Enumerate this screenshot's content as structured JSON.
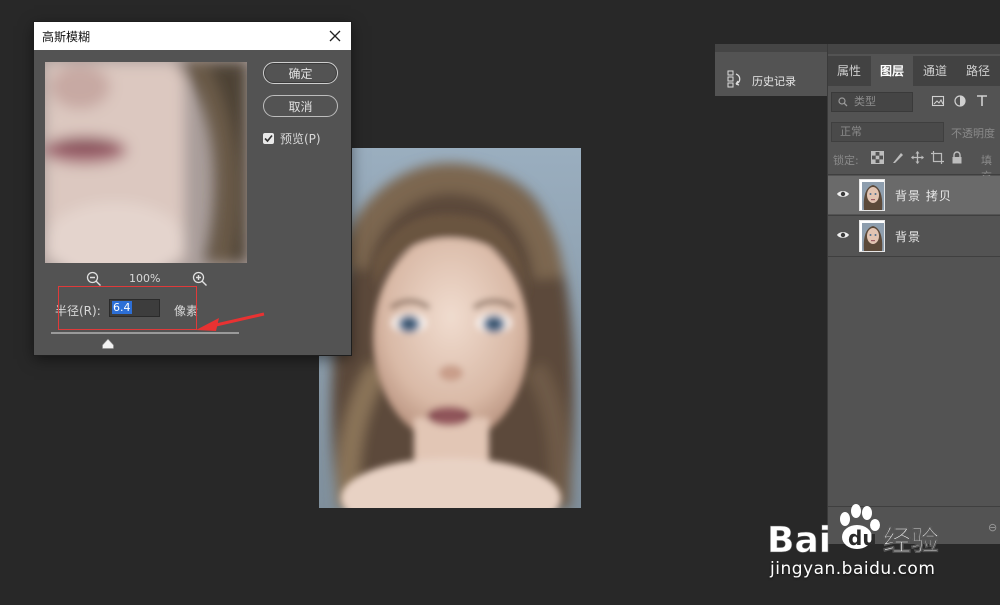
{
  "dialog": {
    "title": "高斯模糊",
    "ok_label": "确定",
    "cancel_label": "取消",
    "preview_label": "预览(P)",
    "preview_checked": true,
    "zoom_level": "100%",
    "radius_label": "半径(R):",
    "radius_value": "6.4",
    "radius_unit": "像素"
  },
  "history_panel": {
    "label": "历史记录"
  },
  "layers_panel": {
    "tabs": [
      "属性",
      "图层",
      "通道",
      "路径"
    ],
    "active_tab": "图层",
    "filter_placeholder": "类型",
    "blend_mode": "正常",
    "opacity_label": "不透明度",
    "lock_label": "锁定:",
    "fill_label": "填充",
    "layers": [
      {
        "name": "背景 拷贝",
        "selected": true,
        "visible": true
      },
      {
        "name": "背景",
        "selected": false,
        "visible": true
      }
    ]
  },
  "watermark": {
    "brand": "Bai du 经验",
    "url": "jingyan.baidu.com"
  },
  "colors": {
    "workspace": "#282828",
    "panel": "#535353",
    "selected_layer": "#6a6a6a",
    "annotation_red": "#e03a3a",
    "selection_blue": "#2d6fd6"
  }
}
